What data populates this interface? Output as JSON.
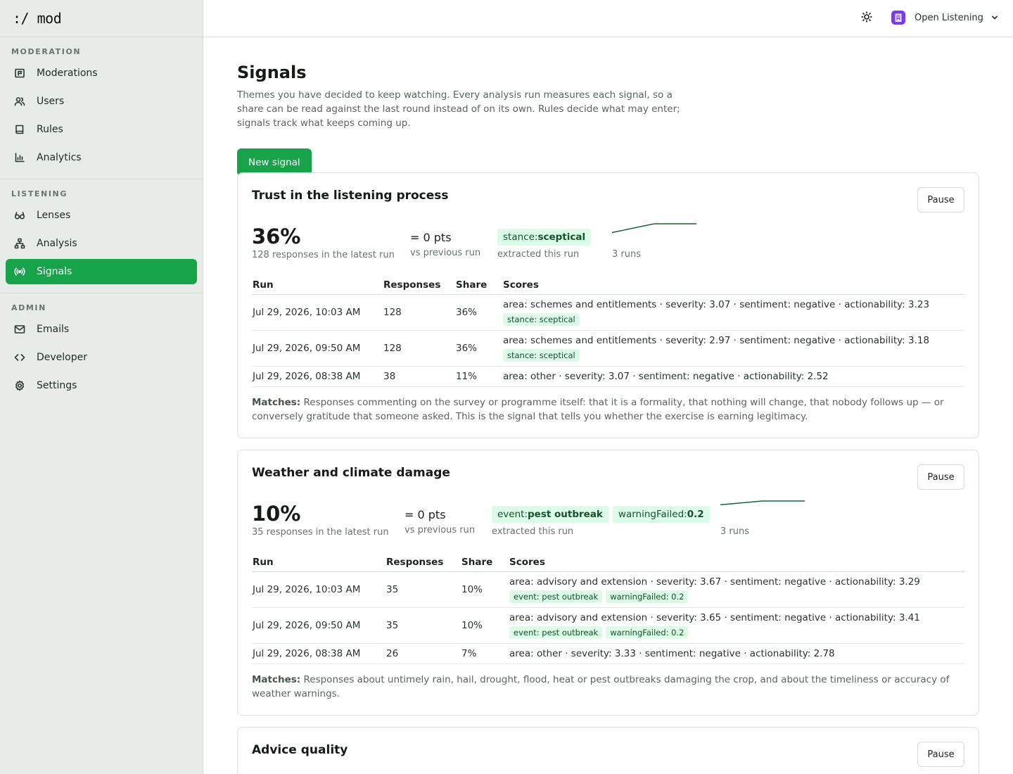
{
  "brand": ":/ mod",
  "sidebar": {
    "sections": [
      {
        "heading": "MODERATION",
        "items": [
          "Moderations",
          "Users",
          "Rules",
          "Analytics"
        ]
      },
      {
        "heading": "LISTENING",
        "items": [
          "Lenses",
          "Analysis",
          "Signals"
        ]
      },
      {
        "heading": "ADMIN",
        "items": [
          "Emails",
          "Developer",
          "Settings"
        ]
      }
    ],
    "active": "Signals"
  },
  "topbar": {
    "org_name": "Open Listening"
  },
  "page": {
    "title": "Signals",
    "description": "Themes you have decided to keep watching. Every analysis run measures each signal, so a share can be read against the last round instead of on its own. Rules decide what may enter; signals track what keeps coming up.",
    "new_button": "New signal"
  },
  "table_headers": {
    "run": "Run",
    "responses": "Responses",
    "share": "Share",
    "scores": "Scores"
  },
  "signals": [
    {
      "title": "Trust in the listening process",
      "pause_label": "Pause",
      "share": "36%",
      "share_sub": "128 responses in the latest run",
      "delta": "= 0 pts",
      "delta_sub": "vs previous run",
      "chips": [
        {
          "key": "stance:",
          "value": "sceptical"
        }
      ],
      "chips_sub": "extracted this run",
      "spark_values": [
        11,
        36,
        36
      ],
      "spark_sub": "3 runs",
      "runs": [
        {
          "run": "Jul 29, 2026, 10:03 AM",
          "responses": "128",
          "share": "36%",
          "scores": "area: schemes and entitlements · severity: 3.07 · sentiment: negative · actionability: 3.23",
          "tags": [
            "stance: sceptical"
          ]
        },
        {
          "run": "Jul 29, 2026, 09:50 AM",
          "responses": "128",
          "share": "36%",
          "scores": "area: schemes and entitlements · severity: 2.97 · sentiment: negative · actionability: 3.18",
          "tags": [
            "stance: sceptical"
          ]
        },
        {
          "run": "Jul 29, 2026, 08:38 AM",
          "responses": "38",
          "share": "11%",
          "scores": "area: other · severity: 3.07 · sentiment: negative · actionability: 2.52",
          "tags": []
        }
      ],
      "matches_label": "Matches:",
      "matches": "Responses commenting on the survey or programme itself: that it is a formality, that nothing will change, that nobody follows up — or conversely gratitude that someone asked. This is the signal that tells you whether the exercise is earning legitimacy."
    },
    {
      "title": "Weather and climate damage",
      "pause_label": "Pause",
      "share": "10%",
      "share_sub": "35 responses in the latest run",
      "delta": "= 0 pts",
      "delta_sub": "vs previous run",
      "chips": [
        {
          "key": "event:",
          "value": "pest outbreak"
        },
        {
          "key": "warningFailed:",
          "value": "0.2"
        }
      ],
      "chips_sub": "extracted this run",
      "spark_values": [
        7,
        10,
        10
      ],
      "spark_sub": "3 runs",
      "runs": [
        {
          "run": "Jul 29, 2026, 10:03 AM",
          "responses": "35",
          "share": "10%",
          "scores": "area: advisory and extension · severity: 3.67 · sentiment: negative · actionability: 3.29",
          "tags": [
            "event: pest outbreak",
            "warningFailed: 0.2"
          ]
        },
        {
          "run": "Jul 29, 2026, 09:50 AM",
          "responses": "35",
          "share": "10%",
          "scores": "area: advisory and extension · severity: 3.65 · sentiment: negative · actionability: 3.41",
          "tags": [
            "event: pest outbreak",
            "warningFailed: 0.2"
          ]
        },
        {
          "run": "Jul 29, 2026, 08:38 AM",
          "responses": "26",
          "share": "7%",
          "scores": "area: other · severity: 3.33 · sentiment: negative · actionability: 2.78",
          "tags": []
        }
      ],
      "matches_label": "Matches:",
      "matches": "Responses about untimely rain, hail, drought, flood, heat or pest outbreaks damaging the crop, and about the timeliness or accuracy of weather warnings."
    },
    {
      "title": "Advice quality",
      "pause_label": "Pause"
    }
  ],
  "colors": {
    "accent": "#16a34a",
    "chip_bg": "#dcfce7",
    "chip_text": "#14532d",
    "org_badge": "#7c3aed",
    "sparkline": "#166534"
  }
}
